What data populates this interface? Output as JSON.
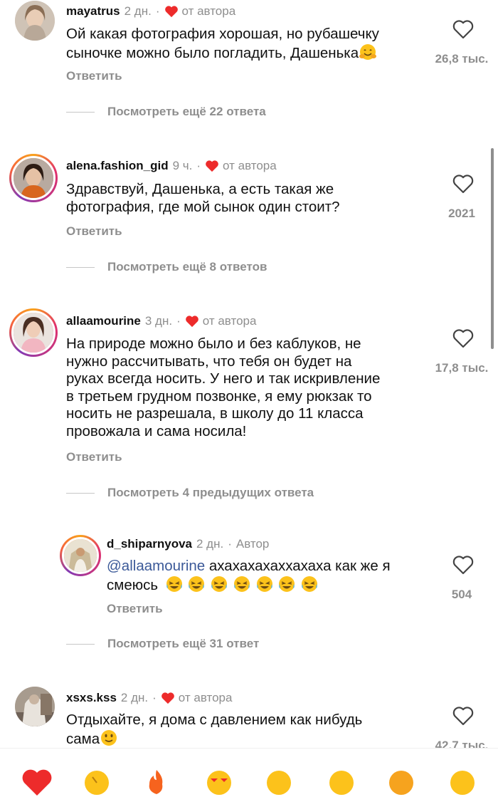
{
  "comments": [
    {
      "username": "mayatrus",
      "time": "2 дн.",
      "dot": "·",
      "badge": "от автора",
      "lines": [
        "Ой какая фотография хорошая, но рубашечку",
        "сыночке можно было погладить, Дашенька"
      ],
      "likes": "26,8 тыс.",
      "reply": "Ответить",
      "more": "Посмотреть ещё 22 ответа"
    },
    {
      "username": "alena.fashion_gid",
      "time": "9 ч.",
      "dot": "·",
      "badge": "от автора",
      "lines": [
        "Здравствуй, Дашенька, а есть такая же",
        "фотография, где мой сынок один стоит?"
      ],
      "likes": "2021",
      "reply": "Ответить",
      "more": "Посмотреть ещё 8 ответов"
    },
    {
      "username": "allaamourine",
      "time": "3 дн.",
      "dot": "·",
      "badge": "от автора",
      "lines": [
        "На природе можно было и без каблуков, не",
        "нужно рассчитывать, что тебя он будет на",
        "руках всегда носить. У него и так искривление",
        "в третьем грудном позвонке, я ему рюкзак то",
        "носить не разрешала, в школу до 11 класса",
        "провожала и сама носила!"
      ],
      "likes": "17,8 тыс.",
      "reply": "Ответить",
      "more": "Посмотреть 4 предыдущих ответа"
    },
    {
      "username": "d_shiparnyova",
      "time": "2 дн.",
      "dot": "·",
      "badge": "Автор",
      "mention": "@allaamourine",
      "line1_rest": " ахахахахаххахаха как же я",
      "line2": "смеюсь",
      "likes": "504",
      "reply": "Ответить",
      "more": "Посмотреть ещё 31 ответ"
    },
    {
      "username": "xsxs.kss",
      "time": "2 дн.",
      "dot": "·",
      "badge": "от автора",
      "lines": [
        "Отдыхайте, я дома с давлением как нибудь",
        "сама"
      ],
      "likes": "42,7 тыс."
    }
  ],
  "colors": {
    "heart_red": "#ed2b2b",
    "meta_gray": "#8e8e8e",
    "mention_blue": "#3b5998"
  },
  "icons": [
    "heart-outline-icon",
    "author-heart-icon",
    "smiling-hug-emoji",
    "crying-laughing-emoji",
    "slightly-smiling-emoji"
  ]
}
